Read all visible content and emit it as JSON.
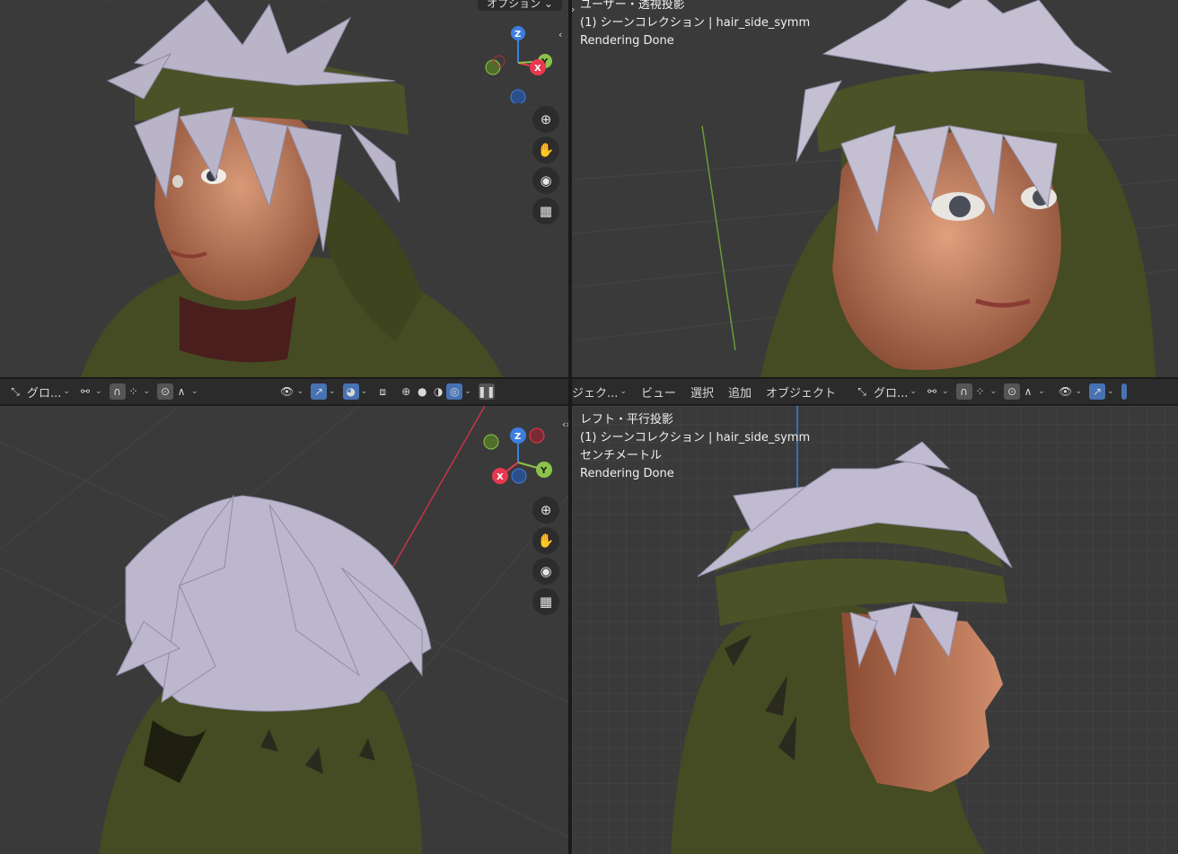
{
  "viewports": {
    "top_right": {
      "lines": [
        "ユーザー・透視投影",
        "(1) シーンコレクション | hair_side_symm",
        "Rendering Done"
      ]
    },
    "bottom_right": {
      "lines": [
        "レフト・平行投影",
        "(1) シーンコレクション | hair_side_symm",
        "センチメートル",
        "Rendering Done"
      ]
    },
    "top_left": {
      "options_label": "オプション ⌄"
    }
  },
  "toolbar_left": {
    "transform_label": "グロ...",
    "shading_modes": [
      "wireframe",
      "solid",
      "material",
      "rendered"
    ],
    "active_shading": "rendered"
  },
  "toolbar_right": {
    "object_mode_label": "ジェク...",
    "menus": [
      "ビュー",
      "選択",
      "追加",
      "オブジェクト"
    ],
    "transform_label": "グロ..."
  },
  "gizmo_axes": {
    "x": "X",
    "y": "Y",
    "z": "Z"
  },
  "colors": {
    "x_axis": "#e8384f",
    "y_axis": "#8bc34a",
    "z_axis": "#3d7ee0",
    "accent": "#4772b3",
    "cloak": "#4a5126",
    "hair": "#bdb8cc",
    "skin": "#c98a6b"
  }
}
